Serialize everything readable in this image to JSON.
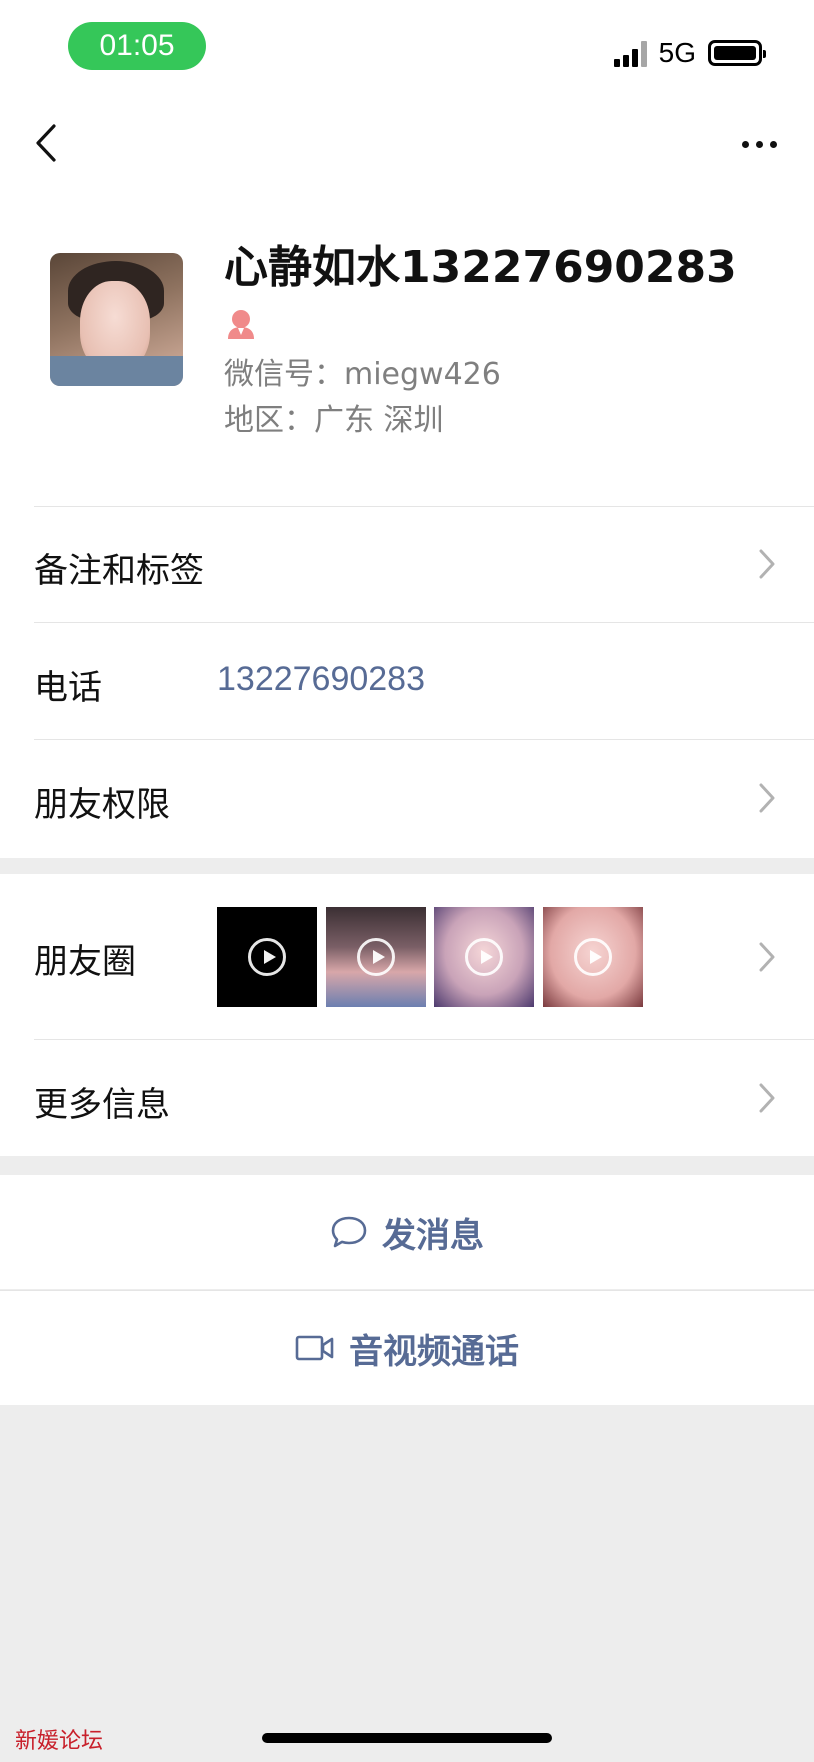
{
  "status_bar": {
    "time": "01:05",
    "network": "5G",
    "icons": [
      "signal-icon",
      "battery-icon"
    ]
  },
  "nav": {
    "back_icon": "chevron-left-icon",
    "more_icon": "more-dots-icon"
  },
  "profile": {
    "name": "心静如水13227690283",
    "gender_icon": "female-icon",
    "wechat_id": "微信号：miegw426",
    "region": "地区：广东 深圳"
  },
  "rows": {
    "remarks_tags": "备注和标签",
    "phone_label": "电话",
    "phone_value": "13227690283",
    "friend_permissions": "朋友权限",
    "moments": "朋友圈",
    "more_info": "更多信息"
  },
  "actions": {
    "send_message": "发消息",
    "av_call": "音视频通话"
  },
  "colors": {
    "link_blue": "#576b95",
    "time_pill_green": "#35c759",
    "gender_icon_pink": "#f08a8a",
    "background_gray": "#ededed"
  },
  "watermark": "新媛论坛"
}
